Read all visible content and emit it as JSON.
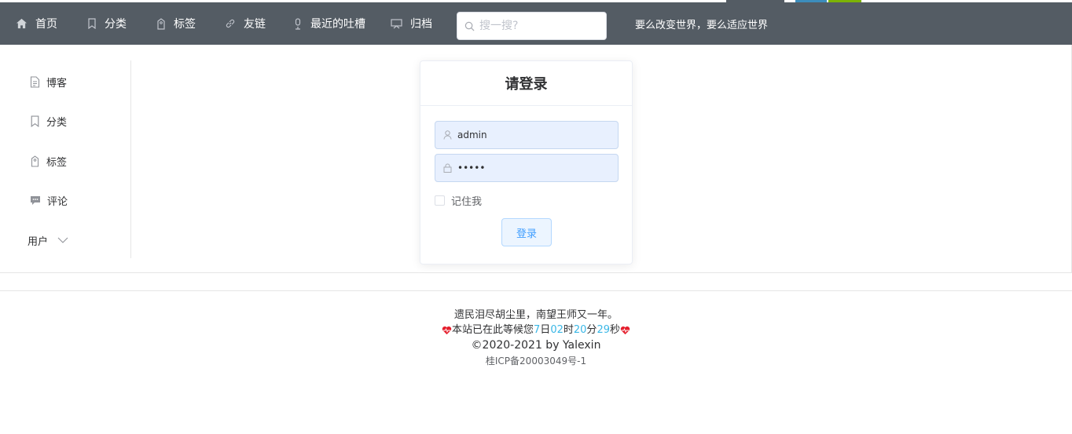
{
  "nav": {
    "items": [
      {
        "label": "首页",
        "icon": "home-icon"
      },
      {
        "label": "分类",
        "icon": "bookmark-icon"
      },
      {
        "label": "标签",
        "icon": "tag-icon"
      },
      {
        "label": "友链",
        "icon": "link-icon"
      },
      {
        "label": "最近的吐槽",
        "icon": "microphone-icon"
      },
      {
        "label": "归档",
        "icon": "archive-icon"
      }
    ],
    "search_placeholder": "搜一搜?",
    "slogan": "要么改变世界，要么适应世界",
    "background": "#545c64"
  },
  "sidebar": {
    "items": [
      {
        "label": "博客",
        "icon": "document-icon"
      },
      {
        "label": "分类",
        "icon": "bookmark-icon"
      },
      {
        "label": "标签",
        "icon": "tag-icon"
      },
      {
        "label": "评论",
        "icon": "comment-icon"
      }
    ],
    "submenu_label": "用户"
  },
  "login": {
    "title": "请登录",
    "username_value": "admin",
    "password_value": "•••••",
    "remember_label": "记住我",
    "submit_label": "登录"
  },
  "footer": {
    "poem": "遗民泪尽胡尘里，南望王师又一年。",
    "timer": {
      "prefix": "本站已在此等候您",
      "days": "7",
      "days_unit": "日",
      "hours": "02",
      "hours_unit": "时",
      "minutes": "20",
      "minutes_unit": "分",
      "seconds": "29",
      "seconds_unit": "秒"
    },
    "copyright": "©2020-2021 by Yalexin",
    "icp": "桂ICP备20003049号-1"
  },
  "colors": {
    "accent": "#409eff",
    "timer_number": "#3ab7e6",
    "heart": "#e5202e"
  }
}
